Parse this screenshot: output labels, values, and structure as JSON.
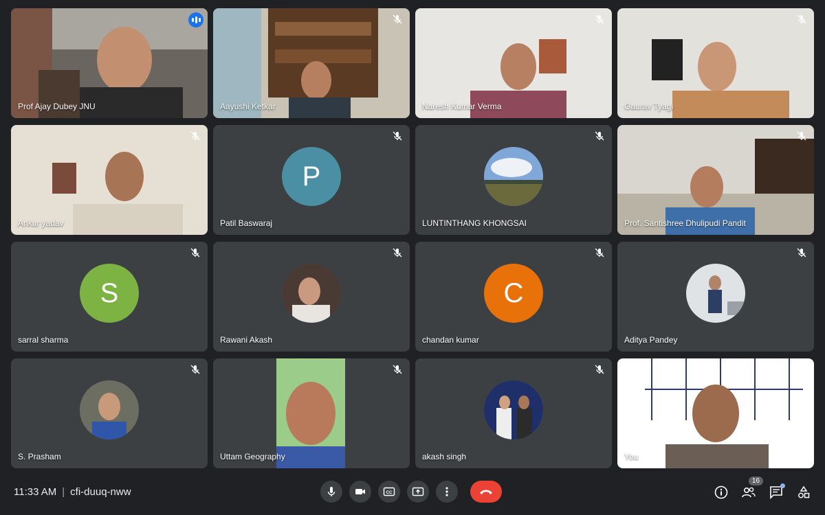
{
  "participants": [
    {
      "name": "Prof Ajay Dubey JNU",
      "status": "speaking"
    },
    {
      "name": "Aayushi Ketkar",
      "status": "muted"
    },
    {
      "name": "Naresh Kumar Verma",
      "status": "muted"
    },
    {
      "name": "Gaurav Tyagi",
      "status": "muted"
    },
    {
      "name": "Ankur yadav",
      "status": "muted"
    },
    {
      "name": "Patil Baswaraj",
      "status": "muted",
      "initial": "P",
      "color": "#4a8fa3"
    },
    {
      "name": "LUNTINTHANG KHONGSAI",
      "status": "muted"
    },
    {
      "name": "Prof. Santishree Dhulipudi Pandit",
      "status": "muted"
    },
    {
      "name": "sarral sharma",
      "status": "muted",
      "initial": "S",
      "color": "#7cb342"
    },
    {
      "name": "Rawani Akash",
      "status": "muted"
    },
    {
      "name": "chandan kumar",
      "status": "muted",
      "initial": "C",
      "color": "#e8710a"
    },
    {
      "name": "Aditya Pandey",
      "status": "muted"
    },
    {
      "name": "S. Prasham",
      "status": "muted"
    },
    {
      "name": "Uttam Geography",
      "status": "muted"
    },
    {
      "name": "akash singh",
      "status": "muted"
    },
    {
      "name": "You",
      "status": "self"
    }
  ],
  "meeting": {
    "time": "11:33 AM",
    "separator": "|",
    "code": "cfi-duuq-nww"
  },
  "toolbar": {
    "participant_count": "16",
    "icons": [
      "mic-icon",
      "camera-icon",
      "captions-icon",
      "present-icon",
      "more-options-icon",
      "end-call-icon"
    ],
    "right_icons": [
      "info-icon",
      "people-icon",
      "chat-icon",
      "activities-icon"
    ]
  },
  "colors": {
    "background": "#202124",
    "tile": "#3c4043",
    "end_call": "#ea4335",
    "active_speaker": "#8ab4f8"
  }
}
